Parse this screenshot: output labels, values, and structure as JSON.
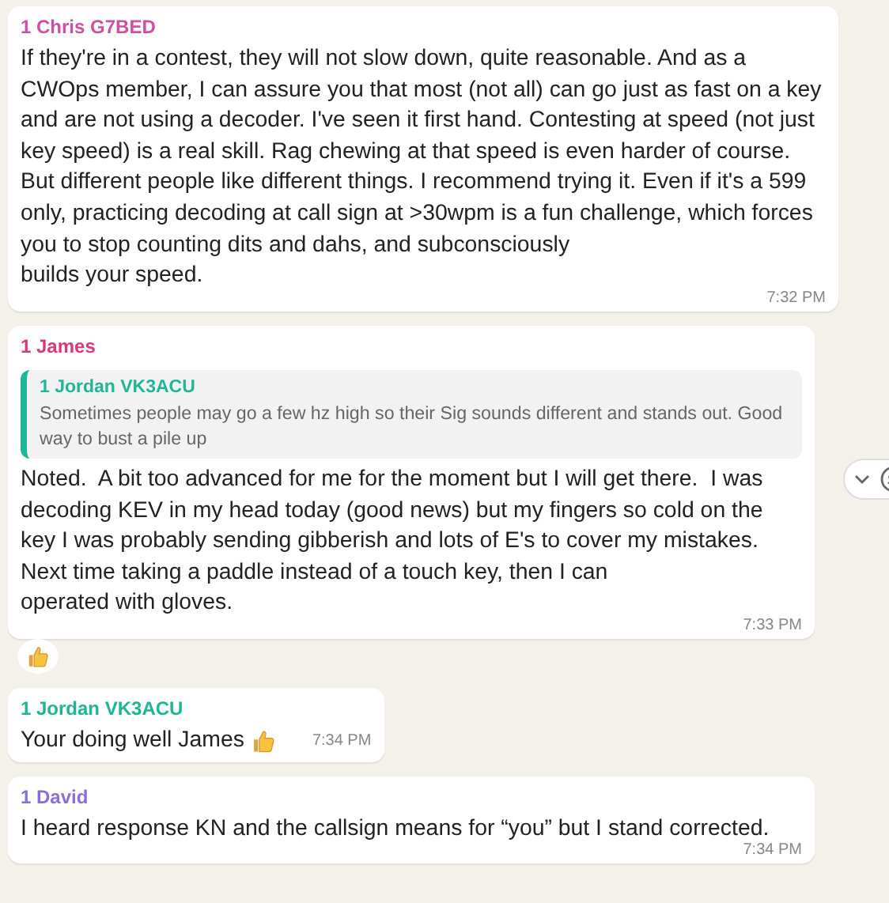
{
  "messages": [
    {
      "sender": "1 Chris G7BED",
      "color": "#d14fa0",
      "text": "If they're in a contest, they will not slow down, quite reasonable. And as a CWOps member, I can assure you that most (not all) can go just as fast on a key and are not using a decoder. I've seen it first hand. Contesting at speed (not just key speed) is a real skill. Rag chewing at that speed is even harder of course. But different people like different things. I recommend trying it. Even if it's a 599 only, practicing decoding at call sign at >30wpm is a fun challenge, which forces you to stop counting dits and dahs, and subconsciously\nbuilds your speed.",
      "time": "7:32 PM"
    },
    {
      "sender": "1 James",
      "color": "#d63a7a",
      "quote": {
        "sender": "1 Jordan VK3ACU",
        "color": "#1fb597",
        "text": "Sometimes people may go a few hz high so their Sig sounds different and stands out. Good way to bust a pile up"
      },
      "text": "Noted.  A bit too advanced for me for the moment but I will get there.  I was decoding KEV in my head today (good news) but my fingers so cold on the key I was probably sending gibberish and lots of E's to cover my mistakes. Next time taking a paddle instead of a touch key, then I can\noperated with gloves.",
      "time": "7:33 PM",
      "thumbs_up_reaction": true,
      "hover_menu": true
    },
    {
      "sender": "1 Jordan VK3ACU",
      "color": "#1fb597",
      "text": "Your doing well James",
      "thumbs_up_emoji": true,
      "time": "7:34 PM"
    },
    {
      "sender": "1 David",
      "color": "#8b6fd6",
      "text": "I heard response KN and the callsign means for “you” but I stand corrected.",
      "time": "7:34 PM"
    }
  ]
}
